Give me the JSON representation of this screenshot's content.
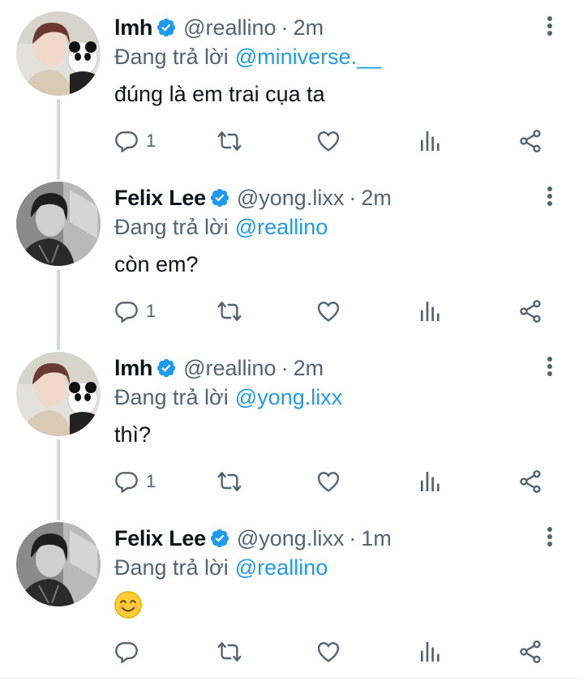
{
  "colors": {
    "accent": "#1d9bf0",
    "muted": "#536471",
    "thread_line": "#cfd9de"
  },
  "tweets": [
    {
      "name": "lmh",
      "handle": "@reallino",
      "dot": "·",
      "time": "2m",
      "reply_prefix": "Đang trả lời",
      "reply_to": "@miniverse.__",
      "text": "đúng là em trai cụa ta",
      "reply_count": "1",
      "avatar_icon": "avatar-lmh"
    },
    {
      "name": "Felix Lee",
      "handle": "@yong.lixx",
      "dot": "·",
      "time": "2m",
      "reply_prefix": "Đang trả lời",
      "reply_to": "@reallino",
      "text": "còn em?",
      "reply_count": "1",
      "avatar_icon": "avatar-felix"
    },
    {
      "name": "lmh",
      "handle": "@reallino",
      "dot": "·",
      "time": "2m",
      "reply_prefix": "Đang trả lời",
      "reply_to": "@yong.lixx",
      "text": "thì?",
      "reply_count": "1",
      "avatar_icon": "avatar-lmh"
    },
    {
      "name": "Felix Lee",
      "handle": "@yong.lixx",
      "dot": "·",
      "time": "1m",
      "reply_prefix": "Đang trả lời",
      "reply_to": "@reallino",
      "text": "",
      "emoji_icon": "smiling-face-emoji",
      "reply_count": "",
      "avatar_icon": "avatar-felix"
    }
  ]
}
